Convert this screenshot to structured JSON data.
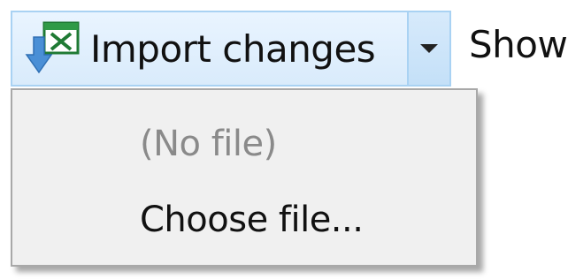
{
  "toolbar": {
    "import_button_label": "Import changes",
    "trailing_label": "Show",
    "import_icon": "import-spreadsheet-icon",
    "dropdown_icon": "chevron-down-icon"
  },
  "menu": {
    "items": [
      {
        "label": "(No file)",
        "enabled": false
      },
      {
        "label": "Choose file...",
        "enabled": true
      }
    ]
  },
  "colors": {
    "button_bg": "#d9ebfb",
    "button_border": "#a9d2f3",
    "menu_bg": "#f0f0f0",
    "disabled_text": "#8a8a8a"
  }
}
